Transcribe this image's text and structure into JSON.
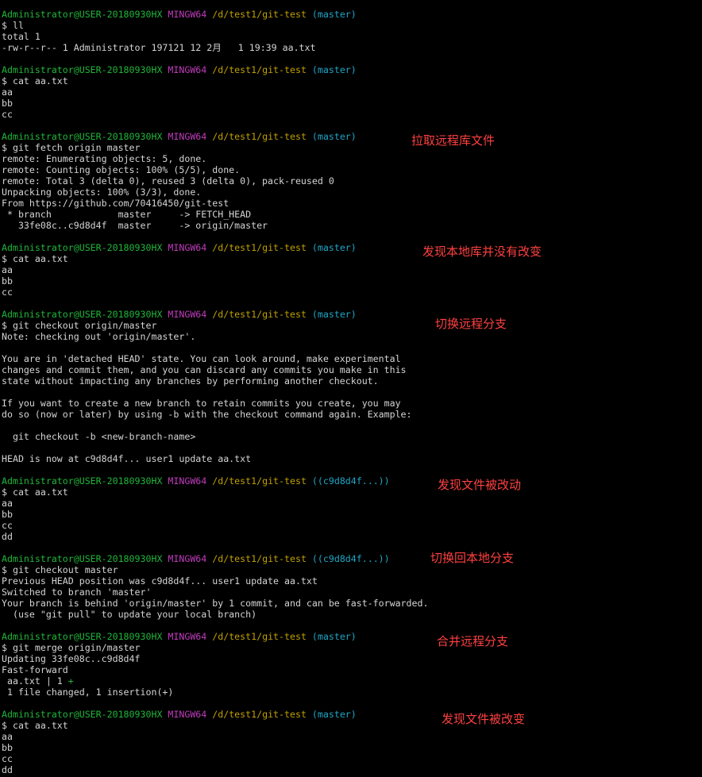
{
  "colors": {
    "background": "#000000",
    "text": "#d4d4d4",
    "prompt_user": "#20b63a",
    "prompt_host": "#c13bbd",
    "prompt_path": "#c0a000",
    "prompt_branch": "#1ea7c7",
    "annotation": "#ff4040"
  },
  "prompt": {
    "user": "Administrator@USER-20180930HX",
    "host": "MINGW64",
    "path": "/d/test1/git-test"
  },
  "lines": [
    {
      "type": "prompt",
      "branch": "(master)"
    },
    {
      "type": "text",
      "text": "$ ll"
    },
    {
      "type": "text",
      "text": "total 1"
    },
    {
      "type": "text",
      "text": "-rw-r--r-- 1 Administrator 197121 12 2月   1 19:39 aa.txt"
    },
    {
      "type": "blank"
    },
    {
      "type": "prompt",
      "branch": "(master)"
    },
    {
      "type": "text",
      "text": "$ cat aa.txt"
    },
    {
      "type": "text",
      "text": "aa"
    },
    {
      "type": "text",
      "text": "bb"
    },
    {
      "type": "text",
      "text": "cc"
    },
    {
      "type": "blank"
    },
    {
      "type": "prompt",
      "branch": "(master)"
    },
    {
      "type": "text",
      "text": "$ git fetch origin master"
    },
    {
      "type": "text",
      "text": "remote: Enumerating objects: 5, done."
    },
    {
      "type": "text",
      "text": "remote: Counting objects: 100% (5/5), done."
    },
    {
      "type": "text",
      "text": "remote: Total 3 (delta 0), reused 3 (delta 0), pack-reused 0"
    },
    {
      "type": "text",
      "text": "Unpacking objects: 100% (3/3), done."
    },
    {
      "type": "text",
      "text": "From https://github.com/70416450/git-test"
    },
    {
      "type": "text",
      "text": " * branch            master     -> FETCH_HEAD"
    },
    {
      "type": "text",
      "text": "   33fe08c..c9d8d4f  master     -> origin/master"
    },
    {
      "type": "blank"
    },
    {
      "type": "prompt",
      "branch": "(master)"
    },
    {
      "type": "text",
      "text": "$ cat aa.txt"
    },
    {
      "type": "text",
      "text": "aa"
    },
    {
      "type": "text",
      "text": "bb"
    },
    {
      "type": "text",
      "text": "cc"
    },
    {
      "type": "blank"
    },
    {
      "type": "prompt",
      "branch": "(master)"
    },
    {
      "type": "text",
      "text": "$ git checkout origin/master"
    },
    {
      "type": "text",
      "text": "Note: checking out 'origin/master'."
    },
    {
      "type": "blank"
    },
    {
      "type": "text",
      "text": "You are in 'detached HEAD' state. You can look around, make experimental"
    },
    {
      "type": "text",
      "text": "changes and commit them, and you can discard any commits you make in this"
    },
    {
      "type": "text",
      "text": "state without impacting any branches by performing another checkout."
    },
    {
      "type": "blank"
    },
    {
      "type": "text",
      "text": "If you want to create a new branch to retain commits you create, you may"
    },
    {
      "type": "text",
      "text": "do so (now or later) by using -b with the checkout command again. Example:"
    },
    {
      "type": "blank"
    },
    {
      "type": "text",
      "text": "  git checkout -b <new-branch-name>"
    },
    {
      "type": "blank"
    },
    {
      "type": "text",
      "text": "HEAD is now at c9d8d4f... user1 update aa.txt"
    },
    {
      "type": "blank"
    },
    {
      "type": "prompt",
      "branch": "((c9d8d4f...))"
    },
    {
      "type": "text",
      "text": "$ cat aa.txt"
    },
    {
      "type": "text",
      "text": "aa"
    },
    {
      "type": "text",
      "text": "bb"
    },
    {
      "type": "text",
      "text": "cc"
    },
    {
      "type": "text",
      "text": "dd"
    },
    {
      "type": "blank"
    },
    {
      "type": "prompt",
      "branch": "((c9d8d4f...))"
    },
    {
      "type": "text",
      "text": "$ git checkout master"
    },
    {
      "type": "text",
      "text": "Previous HEAD position was c9d8d4f... user1 update aa.txt"
    },
    {
      "type": "text",
      "text": "Switched to branch 'master'"
    },
    {
      "type": "text",
      "text": "Your branch is behind 'origin/master' by 1 commit, and can be fast-forwarded."
    },
    {
      "type": "text",
      "text": "  (use \"git pull\" to update your local branch)"
    },
    {
      "type": "blank"
    },
    {
      "type": "prompt",
      "branch": "(master)"
    },
    {
      "type": "text",
      "text": "$ git merge origin/master"
    },
    {
      "type": "text",
      "text": "Updating 33fe08c..c9d8d4f"
    },
    {
      "type": "text",
      "text": "Fast-forward"
    },
    {
      "type": "stat",
      "text": " aa.txt | 1 ",
      "plus": "+"
    },
    {
      "type": "text",
      "text": " 1 file changed, 1 insertion(+)"
    },
    {
      "type": "blank"
    },
    {
      "type": "prompt",
      "branch": "(master)"
    },
    {
      "type": "text",
      "text": "$ cat aa.txt"
    },
    {
      "type": "text",
      "text": "aa"
    },
    {
      "type": "text",
      "text": "bb"
    },
    {
      "type": "text",
      "text": "cc"
    },
    {
      "type": "text",
      "text": "dd"
    }
  ],
  "annotations": {
    "fetch_remote": "拉取远程库文件",
    "local_unchanged": "发现本地库并没有改变",
    "switch_remote": "切换远程分支",
    "file_modified": "发现文件被改动",
    "switch_local": "切换回本地分支",
    "merge_remote": "合并远程分支",
    "file_changed": "发现文件被改变"
  }
}
